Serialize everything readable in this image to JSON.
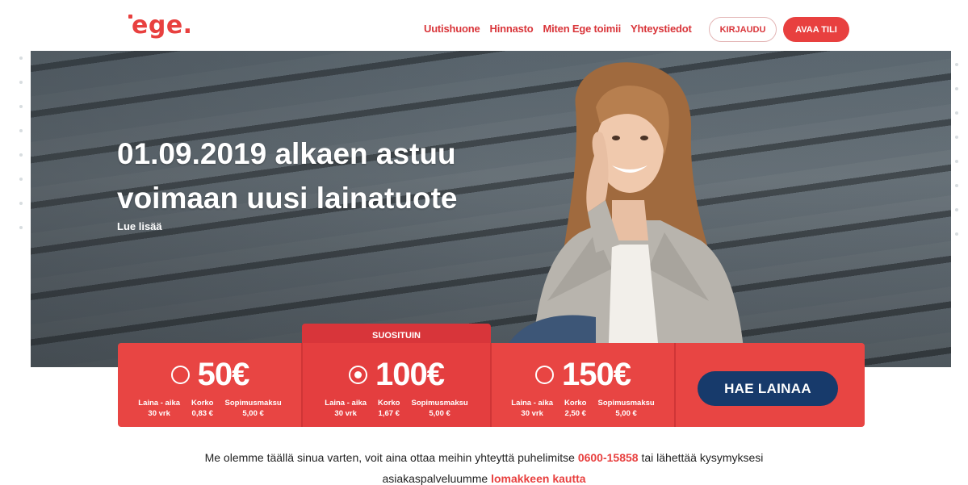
{
  "header": {
    "logo_text": "ege.",
    "nav": [
      {
        "label": "Uutishuone"
      },
      {
        "label": "Hinnasto"
      },
      {
        "label": "Miten Ege toimii"
      },
      {
        "label": "Yhteystiedot"
      }
    ],
    "login_label": "KIRJAUDU",
    "open_account_label": "AVAA TILI"
  },
  "hero": {
    "title_line1": "01.09.2019 alkaen astuu",
    "title_line2": "voimaan uusi lainatuote",
    "read_more": "Lue lisää"
  },
  "loan": {
    "popular_label": "SUOSITUIN",
    "apply_label": "HAE LAINAA",
    "options": [
      {
        "amount": "50€",
        "selected": false,
        "term_label": "Laina - aika",
        "term_value": "30 vrk",
        "interest_label": "Korko",
        "interest_value": "0,83 €",
        "fee_label": "Sopimusmaksu",
        "fee_value": "5,00 €"
      },
      {
        "amount": "100€",
        "selected": true,
        "term_label": "Laina - aika",
        "term_value": "30 vrk",
        "interest_label": "Korko",
        "interest_value": "1,67 €",
        "fee_label": "Sopimusmaksu",
        "fee_value": "5,00 €"
      },
      {
        "amount": "150€",
        "selected": false,
        "term_label": "Laina - aika",
        "term_value": "30 vrk",
        "interest_label": "Korko",
        "interest_value": "2,50 €",
        "fee_label": "Sopimusmaksu",
        "fee_value": "5,00 €"
      }
    ]
  },
  "contact": {
    "text_before_phone": "Me olemme täällä sinua varten, voit aina ottaa meihin yhteyttä puhelimitse ",
    "phone": "0600-15858",
    "text_after_phone": " tai lähettää kysymyksesi",
    "text_line2": "asiakaspalveluumme ",
    "form_link": "lomakkeen kautta"
  },
  "colors": {
    "brand_red": "#e8403f",
    "navy": "#173a6b"
  }
}
